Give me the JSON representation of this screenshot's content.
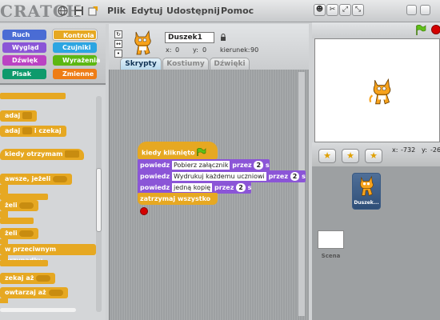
{
  "topbar": {
    "logo": "CRATCH",
    "menu": [
      "Plik",
      "Edytuj",
      "Udostępnij",
      "Pomoc"
    ]
  },
  "categories": [
    {
      "label": "Ruch",
      "color": "#4a6cd4"
    },
    {
      "label": "Kontrola",
      "color": "#e6a822",
      "selected": true
    },
    {
      "label": "Wygląd",
      "color": "#8a55d7"
    },
    {
      "label": "Czujniki",
      "color": "#2ca5e2"
    },
    {
      "label": "Dźwięk",
      "color": "#bb42c3"
    },
    {
      "label": "Wyrażenia",
      "color": "#5cb712"
    },
    {
      "label": "Pisak",
      "color": "#0e9a6c"
    },
    {
      "label": "Zmienne",
      "color": "#ee7d16"
    }
  ],
  "palette": {
    "block_zadaj": "adaj",
    "block_zadaj_czekaj": "adaj",
    "block_zadaj_czekaj_suffix": "i czekaj",
    "block_otrzymam": "kiedy otrzymam",
    "block_zawsze_jezeli": "awsze, jeżeli",
    "block_jezeli": "żeli",
    "block_jezeli2": "żeli",
    "block_przeciwnym": "w przeciwnym przypadku",
    "block_czekaj_az": "zekaj aż",
    "block_powtarzaj_az": "owtarzaj aż"
  },
  "sprite": {
    "name": "Duszek1",
    "x_label": "x:",
    "x_value": "0",
    "y_label": "y:",
    "y_value": "0",
    "dir_label": "kierunek:",
    "dir_value": "90"
  },
  "tabs": [
    "Skrypty",
    "Kostiumy",
    "Dźwięki"
  ],
  "script": {
    "hat": "kiedy kliknięto",
    "say1": {
      "verb": "powiedz",
      "text": "Pobierz załącznik",
      "for": "przez",
      "secs": "2",
      "unit": "s"
    },
    "say2": {
      "verb": "powiedz",
      "text": "Wydrukuj każdemu uczniowi",
      "for": "przez",
      "secs": "2",
      "unit": "s"
    },
    "say3": {
      "verb": "powiedz",
      "text": "jedną kopię",
      "for": "przez",
      "secs": "2",
      "unit": "s"
    },
    "stop": "zatrzymaj wszystko"
  },
  "stage": {
    "mouse_x_label": "x:",
    "mouse_x": "-732",
    "mouse_y_label": "y:",
    "mouse_y": "-26"
  },
  "library": {
    "sprite_label": "Duszek...",
    "scene_label": "Scena"
  }
}
